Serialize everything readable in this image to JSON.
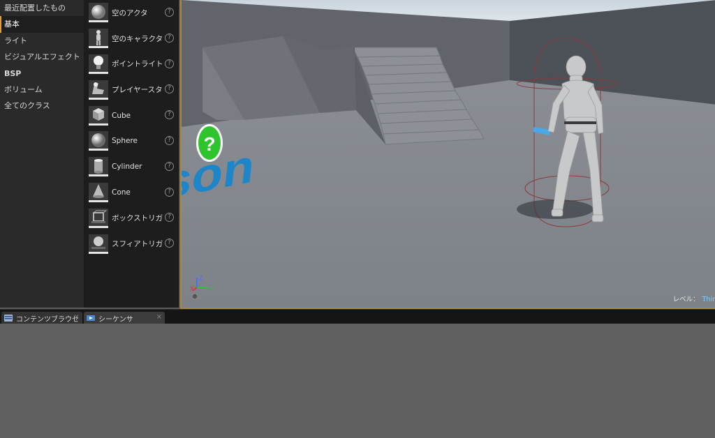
{
  "categories": [
    {
      "label": "最近配置したもの",
      "active": false,
      "bold": false
    },
    {
      "label": "基本",
      "active": true,
      "bold": false
    },
    {
      "label": "ライト",
      "active": false,
      "bold": false
    },
    {
      "label": "ビジュアルエフェクト",
      "active": false,
      "bold": false
    },
    {
      "label": "BSP",
      "active": false,
      "bold": true
    },
    {
      "label": "ボリューム",
      "active": false,
      "bold": false
    },
    {
      "label": "全てのクラス",
      "active": false,
      "bold": false
    }
  ],
  "items": [
    {
      "label": "空のアクタ",
      "icon": "sphere-icon"
    },
    {
      "label": "空のキャラクタ",
      "icon": "character-icon"
    },
    {
      "label": "ポイントライト",
      "icon": "lightbulb-icon"
    },
    {
      "label": "プレイヤースタ",
      "icon": "player-start-icon"
    },
    {
      "label": "Cube",
      "icon": "cube-icon"
    },
    {
      "label": "Sphere",
      "icon": "sphere-icon"
    },
    {
      "label": "Cylinder",
      "icon": "cylinder-icon"
    },
    {
      "label": "Cone",
      "icon": "cone-icon"
    },
    {
      "label": "ボックストリガ",
      "icon": "box-trigger-icon"
    },
    {
      "label": "スフィアトリガ",
      "icon": "sphere-trigger-icon"
    }
  ],
  "help_glyph": "?",
  "viewport": {
    "floor_text": "erson",
    "axis_labels": {
      "x": "X",
      "y": "Y",
      "z": "Z"
    },
    "question_glyph": "?",
    "level_label": "レベル：",
    "level_value": "Thir"
  },
  "tabs": [
    {
      "label": "コンテンツブラウセ",
      "close": "×",
      "active": false
    },
    {
      "label": "シーケンサ",
      "close": "×",
      "active": true
    }
  ],
  "colors": {
    "accent": "#e0a030",
    "floor_text": "#1e86c8",
    "question_marker": "#2ec42e"
  }
}
